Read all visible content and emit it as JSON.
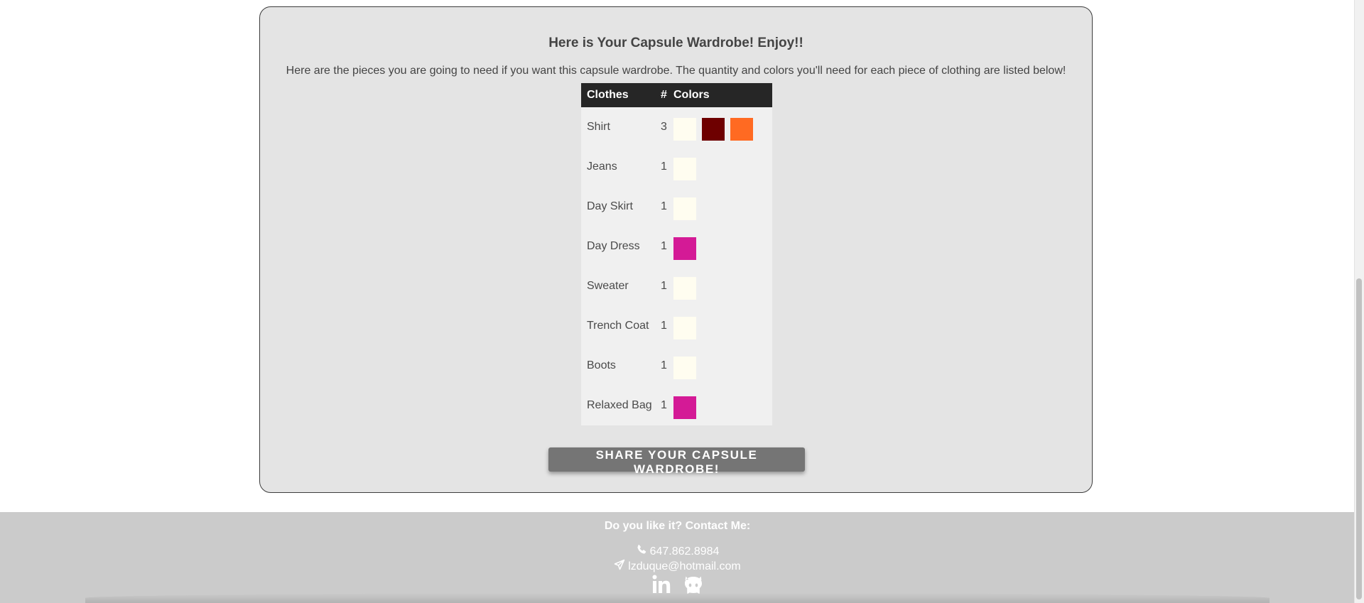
{
  "card": {
    "title": "Here is Your Capsule Wardrobe! Enjoy!!",
    "intro": "Here are the pieces you are going to need if you want this capsule wardrobe. The quantity and colors you'll need for each piece of clothing are listed below!"
  },
  "table": {
    "headers": {
      "clothes": "Clothes",
      "qty": "#",
      "colors": "Colors"
    },
    "rows": [
      {
        "name": "Shirt",
        "qty": "3",
        "colors": [
          "#fffdf0",
          "#6e0000",
          "#ff6a22"
        ]
      },
      {
        "name": "Jeans",
        "qty": "1",
        "colors": [
          "#fffdf0"
        ]
      },
      {
        "name": "Day Skirt",
        "qty": "1",
        "colors": [
          "#fffdf0"
        ]
      },
      {
        "name": "Day Dress",
        "qty": "1",
        "colors": [
          "#d41a96"
        ]
      },
      {
        "name": "Sweater",
        "qty": "1",
        "colors": [
          "#fffdf0"
        ]
      },
      {
        "name": "Trench Coat",
        "qty": "1",
        "colors": [
          "#fffdf0"
        ]
      },
      {
        "name": "Boots",
        "qty": "1",
        "colors": [
          "#fffdf0"
        ]
      },
      {
        "name": "Relaxed Bag",
        "qty": "1",
        "colors": [
          "#d41a96"
        ]
      }
    ]
  },
  "share_button": {
    "label": "SHARE YOUR CAPSULE WARDROBE!"
  },
  "footer": {
    "title": "Do you like it? Contact Me:",
    "phone": "647.862.8984",
    "email": "lzduque@hotmail.com",
    "icons": [
      "phone-icon",
      "send-icon",
      "linkedin-icon",
      "github-icon"
    ]
  },
  "colors": {
    "card_background": "#e4e4e4",
    "table_header": "#262626",
    "footer_background": "#cbcbcb",
    "button_background": "#757575"
  }
}
